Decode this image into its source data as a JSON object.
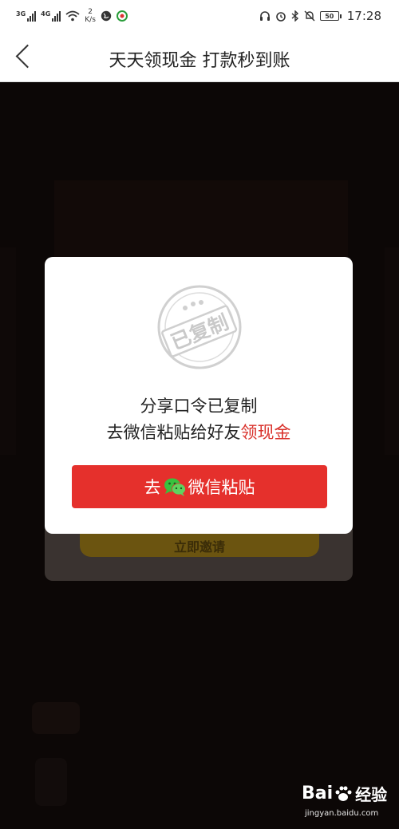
{
  "status_bar": {
    "signal1_label": "3G",
    "signal2_label": "4G",
    "speed_value": "2",
    "speed_unit": "K/s",
    "battery": "50",
    "time": "17:28"
  },
  "nav": {
    "title": "天天领现金 打款秒到账"
  },
  "background": {
    "button_text": "立即邀请"
  },
  "modal": {
    "stamp_text": "已复制",
    "line1": "分享口令已复制",
    "line2_prefix": "去微信粘贴给好友",
    "line2_accent": "领现金",
    "button_prefix": "去",
    "button_suffix": "微信粘贴"
  },
  "watermark": {
    "brand_a": "Bai",
    "brand_b": "经验",
    "url": "jingyan.baidu.com"
  },
  "colors": {
    "accent": "#e5302c",
    "overlay": "#0c0706",
    "wechat_green": "#38c23e"
  }
}
